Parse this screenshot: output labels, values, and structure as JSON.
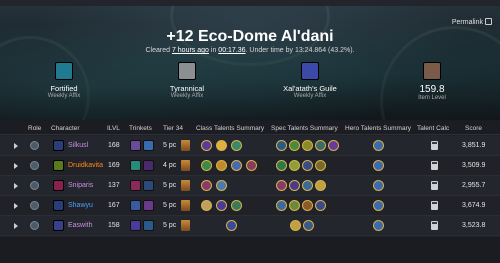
{
  "hero": {
    "title": "+12 Eco-Dome Al'dani",
    "cleared_prefix": "Cleared",
    "cleared_ago": "7 hours ago",
    "in_label": "in",
    "duration": "00:17.36",
    "under_time": ". Under time by 13:24.864 (43.2%).",
    "permalink": "Permalink"
  },
  "affixes": [
    {
      "name": "Fortified",
      "desc": "Weekly Affix",
      "color": "#1f7a92"
    },
    {
      "name": "Tyrannical",
      "desc": "Weekly Affix",
      "color": "#8c8f92"
    },
    {
      "name": "Xal'atath's Guile",
      "desc": "Weekly Affix",
      "color": "#3b4aa8"
    }
  ],
  "item_level": {
    "value": "159.8",
    "label": "Item Level"
  },
  "columns": {
    "role": "Role",
    "character": "Character",
    "ilvl": "ILVL",
    "trinkets": "Trinkets",
    "tier": "Tier 34",
    "class_talents": "Class Talents Summary",
    "spec_talents": "Spec Talents Summary",
    "hero_talents": "Hero Talents Summary",
    "talent_calc": "Talent Calc",
    "score": "Score"
  },
  "rows": [
    {
      "name": "Silkusl",
      "ilvl": "168",
      "tier": "5 pc",
      "score": "3,851.9",
      "name_color": "#c98fe6",
      "icon_color": "#2a3d7a"
    },
    {
      "name": "Druidkavita",
      "ilvl": "169",
      "tier": "4 pc",
      "score": "3,509.9",
      "name_color": "#ff8a1c",
      "icon_color": "#5a7a1e"
    },
    {
      "name": "Sniparis",
      "ilvl": "137",
      "tier": "5 pc",
      "score": "2,955.7",
      "name_color": "#c98fe6",
      "icon_color": "#8a2050"
    },
    {
      "name": "Shawyu",
      "ilvl": "167",
      "tier": "5 pc",
      "score": "3,674.9",
      "name_color": "#4aa0ff",
      "icon_color": "#283e7a"
    },
    {
      "name": "Easwith",
      "ilvl": "158",
      "tier": "5 pc",
      "score": "3,523.8",
      "name_color": "#c98fe6",
      "icon_color": "#3a3f8a"
    }
  ]
}
